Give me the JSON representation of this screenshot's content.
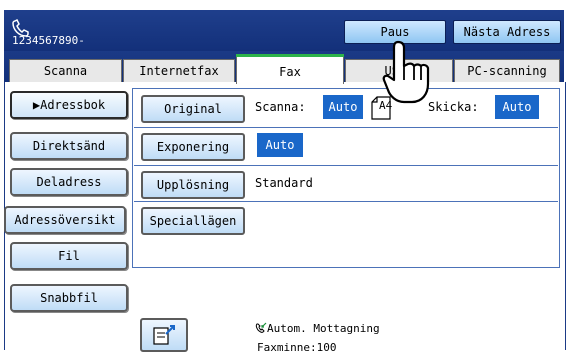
{
  "header": {
    "phone_number": "1234567890-",
    "icon": "phone-icon",
    "buttons": [
      {
        "label": "Paus"
      },
      {
        "label": "Nästa Adress"
      }
    ]
  },
  "tabs": [
    {
      "label": "Scanna"
    },
    {
      "label": "Internetfax"
    },
    {
      "label": "Fax",
      "active": true
    },
    {
      "label": "USB-minnesskann"
    },
    {
      "label": "PC-scanning"
    }
  ],
  "sidebar": {
    "items": [
      {
        "label": "▶Adressbok",
        "active": true
      },
      {
        "label": "Direktsänd"
      },
      {
        "label": "Deladress"
      },
      {
        "label": "Adressöversikt"
      },
      {
        "label": "Fil"
      },
      {
        "label": "Snabbfil"
      }
    ]
  },
  "main": {
    "rows": [
      {
        "button": "Original",
        "scan_label": "Scanna:",
        "scan_value": "Auto",
        "paper": "A4",
        "send_label": "Skicka:",
        "send_value": "Auto"
      },
      {
        "button": "Exponering",
        "value": "Auto"
      },
      {
        "button": "Upplösning",
        "value": "Standard"
      },
      {
        "button": "Speciallägen"
      }
    ]
  },
  "status": {
    "receive": "Autom. Mottagning",
    "memory": "Faxminne:100"
  },
  "colors": {
    "accent": "#1a67c9",
    "header": "#1b3a86",
    "active_tab_indicator": "#2db34a"
  }
}
